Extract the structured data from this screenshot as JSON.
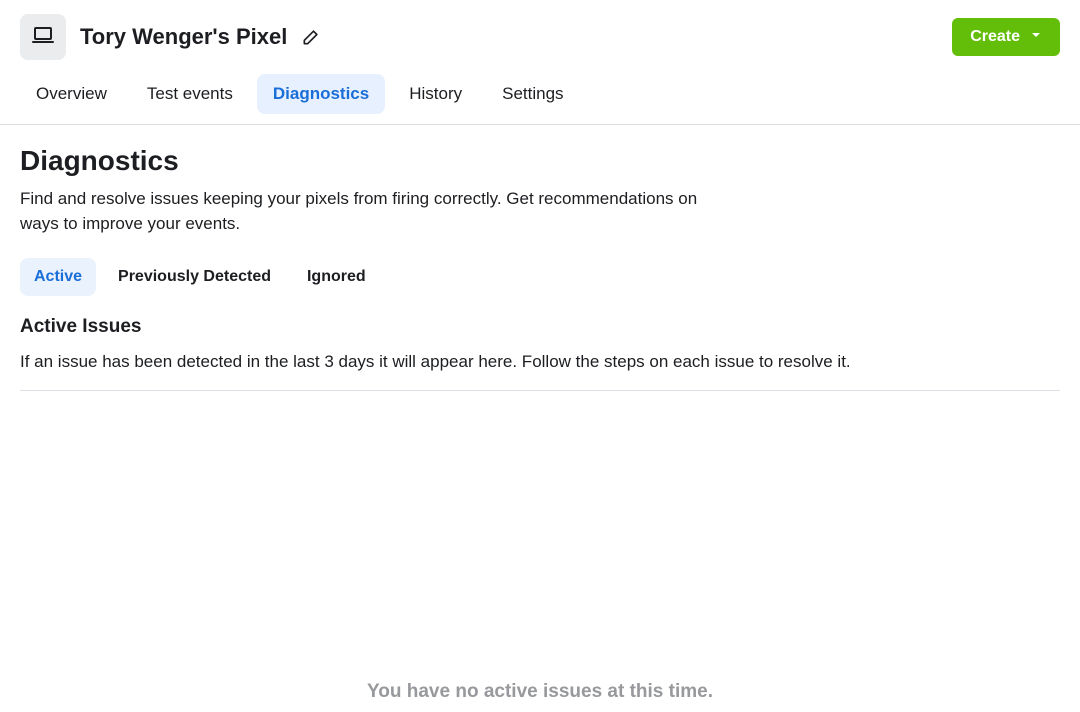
{
  "header": {
    "title": "Tory Wenger's Pixel",
    "create_label": "Create"
  },
  "nav": {
    "tabs": [
      {
        "label": "Overview",
        "active": false
      },
      {
        "label": "Test events",
        "active": false
      },
      {
        "label": "Diagnostics",
        "active": true
      },
      {
        "label": "History",
        "active": false
      },
      {
        "label": "Settings",
        "active": false
      }
    ]
  },
  "page": {
    "heading": "Diagnostics",
    "description": "Find and resolve issues keeping your pixels from firing correctly. Get recommendations on ways to improve your events."
  },
  "subtabs": [
    {
      "label": "Active",
      "active": true
    },
    {
      "label": "Previously Detected",
      "active": false
    },
    {
      "label": "Ignored",
      "active": false
    }
  ],
  "section": {
    "heading": "Active Issues",
    "description": "If an issue has been detected in the last 3 days it will appear here. Follow the steps on each issue to resolve it."
  },
  "empty_state": "You have no active issues at this time."
}
